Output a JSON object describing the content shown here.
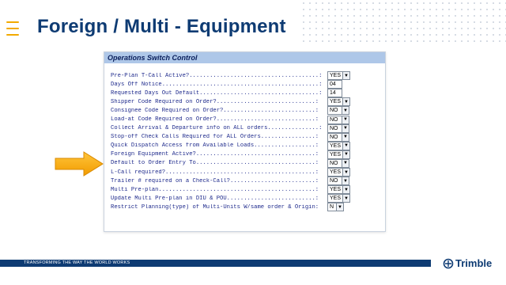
{
  "slide": {
    "title": "Foreign / Multi - Equipment",
    "footer_tagline": "TRANSFORMING THE WAY THE WORLD WORKS",
    "brand": "Trimble"
  },
  "panel": {
    "header": "Operations Switch Control",
    "rows": [
      {
        "label": "Pre-Plan T-Call Active?......................................:",
        "kind": "select",
        "value": "YES"
      },
      {
        "label": "Days Off Notice..............................................:",
        "kind": "text",
        "value": "04"
      },
      {
        "label": "Requested Days Out Default...................................:",
        "kind": "text",
        "value": "14"
      },
      {
        "label": "Shipper Code Required on Order?.............................:",
        "kind": "select",
        "value": "YES"
      },
      {
        "label": "Consignee Code Required on Order?...........................:",
        "kind": "select",
        "value": "NO"
      },
      {
        "label": "Load-at Code Required on Order?.............................:",
        "kind": "select",
        "value": "NO"
      },
      {
        "label": "Collect Arrival & Departure info on ALL orders...............:",
        "kind": "select",
        "value": "NO"
      },
      {
        "label": "Stop-off Check Calls Required for ALL Orders................:",
        "kind": "select",
        "value": "NO"
      },
      {
        "label": "Quick Dispatch Access from Available Loads..................:",
        "kind": "select",
        "value": "YES"
      },
      {
        "label": "Foreign Equipment Active?...................................:",
        "kind": "select",
        "value": "YES"
      },
      {
        "label": "Default to Order Entry To...................................:",
        "kind": "select",
        "value": "NO"
      },
      {
        "label": "L-Call required?............................................:",
        "kind": "select",
        "value": "YES"
      },
      {
        "label": "Trailer # required on a Check-Call?.........................:",
        "kind": "select",
        "value": "NO"
      },
      {
        "label": "Multi Pre-plan..............................................:",
        "kind": "select",
        "value": "YES"
      },
      {
        "label": "Update Multi Pre-plan in DIU & POU..........................:",
        "kind": "select",
        "value": "YES"
      },
      {
        "label": "Restrict Planning(type) of Multi-Units W/same order & Origin:",
        "kind": "select",
        "value": "N"
      }
    ]
  },
  "colors": {
    "title": "#0e3b73",
    "accent": "#f2a900",
    "panel_header": "#aec7e8",
    "label_text": "#1e2a8c"
  },
  "icons": {
    "menu": "hamburger-icon",
    "pointer": "arrow-right-icon",
    "brand": "trimble-logo-icon"
  }
}
